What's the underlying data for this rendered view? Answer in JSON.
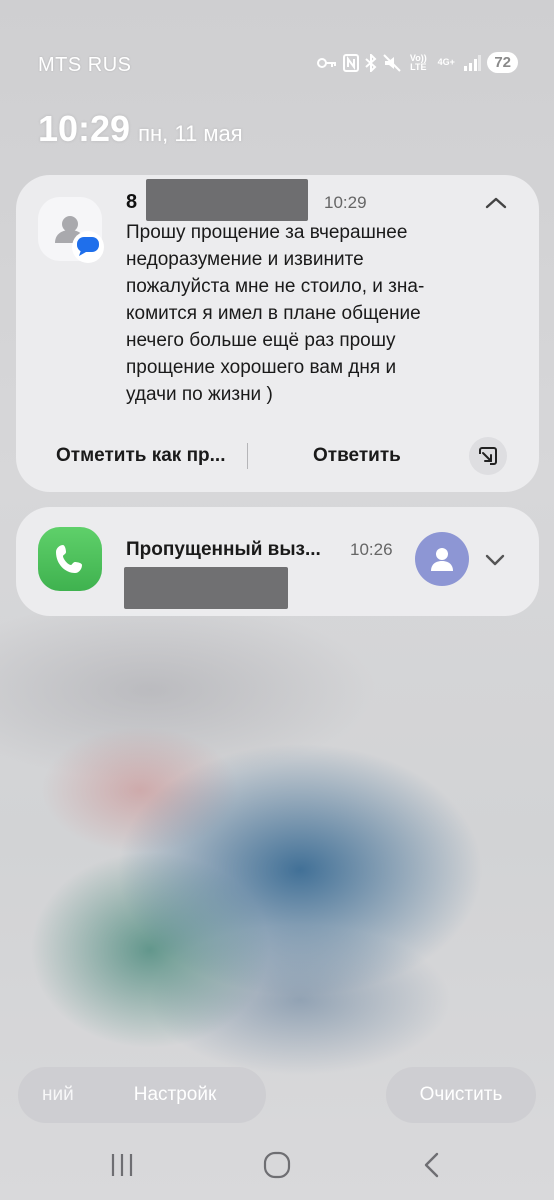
{
  "status_bar": {
    "carrier": "MTS RUS",
    "icons": [
      "key-icon",
      "nfc-icon",
      "bluetooth-icon",
      "mute-icon",
      "volte-icon",
      "4g-icon",
      "signal-icon"
    ],
    "volte_label": "Vo)) LTE",
    "network_label": "4G+",
    "battery": "72"
  },
  "lockscreen": {
    "time": "10:29",
    "date": "пн, 11 мая"
  },
  "message_notification": {
    "sender_prefix": "8",
    "time": "10:29",
    "body": "Прошу прощение за вчерашнее\nнедоразумение и извините\nпожалуйста мне не стоило, и зна-\nкомится я имел в плане общение\nнечего больше ещё раз прошу\nпрощение хорошего вам дня и\nудачи по жизни )",
    "action_mark_read": "Отметить как пр...",
    "action_reply": "Ответить"
  },
  "call_notification": {
    "title": "Пропущенный выз...",
    "time": "10:26"
  },
  "bottom_actions": {
    "history_label_partial": "ний",
    "settings_label": "Настройк",
    "clear_label": "Очистить"
  },
  "colors": {
    "card_bg": "#ececee",
    "phone_green": "#4cc25a",
    "avatar_bg": "#8d96d4",
    "message_badge": "#1f6feb"
  }
}
